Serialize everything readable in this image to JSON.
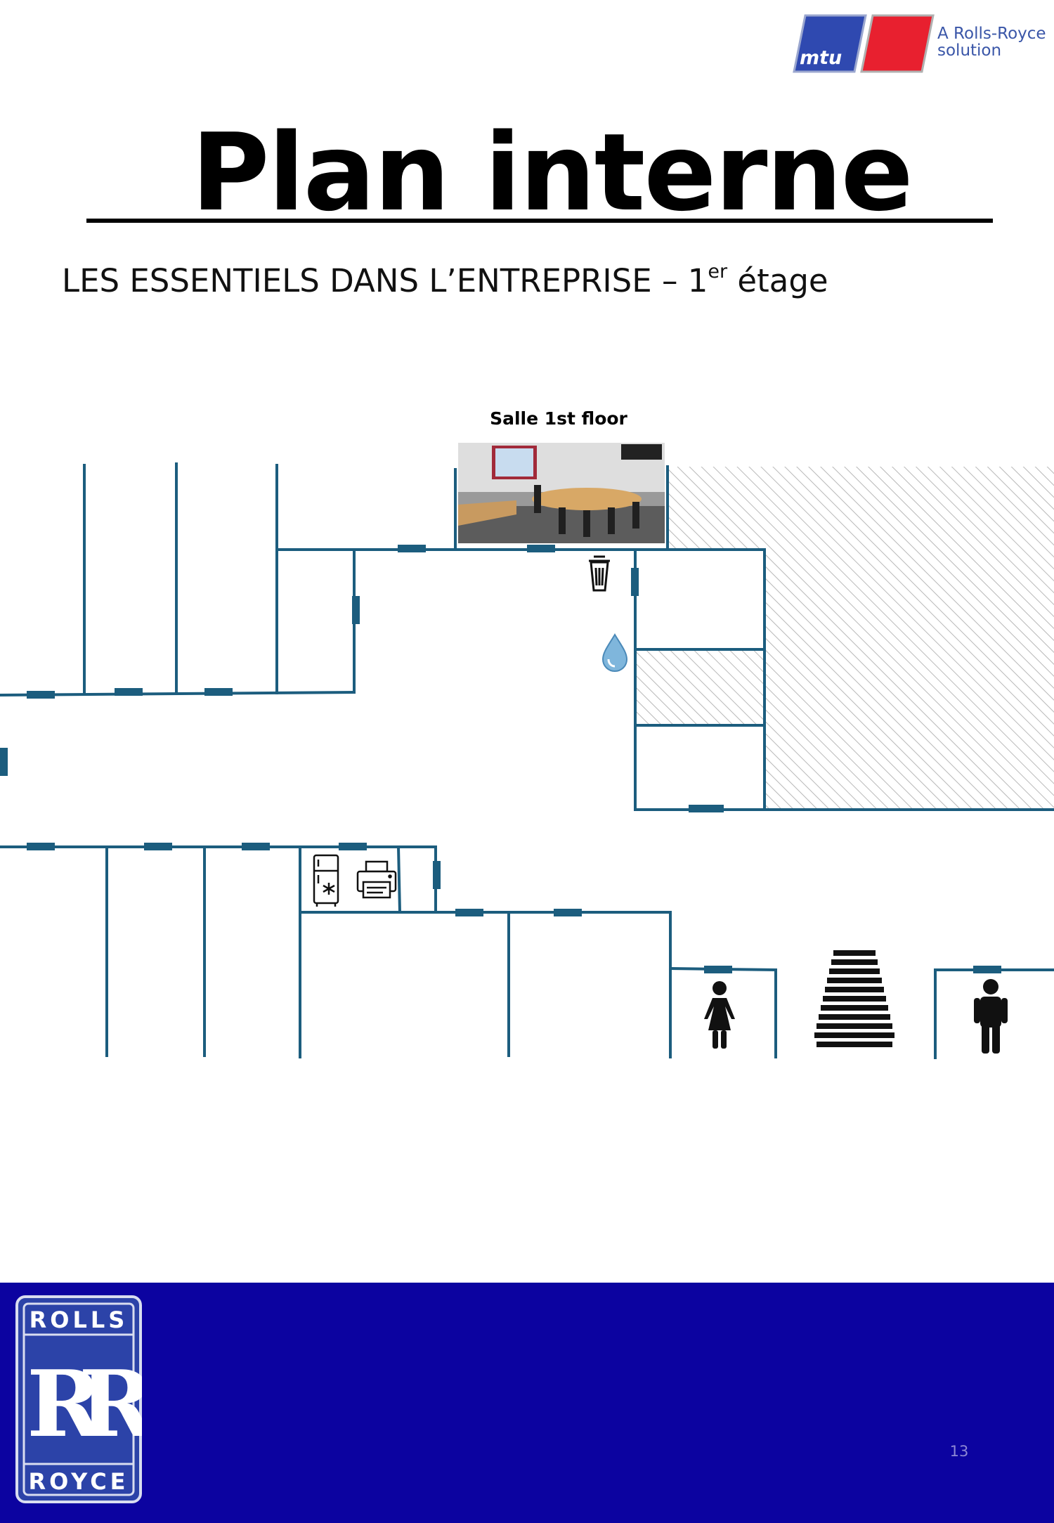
{
  "header": {
    "logo_text": "mtu",
    "brand_line1": "A Rolls-Royce",
    "brand_line2": "solution"
  },
  "title": "Plan interne",
  "subtitle": {
    "text": "LES ESSENTIELS DANS L’ENTREPRISE – 1",
    "superscript": "er",
    "suffix": " étage"
  },
  "meeting_room": {
    "label": "Salle 1st floor"
  },
  "icons": {
    "trash": "trash-icon",
    "water": "water-drop-icon",
    "fridge": "fridge-icon",
    "printer": "printer-icon",
    "women_toilet": "women-toilet-icon",
    "stairs": "stairs-icon",
    "men_toilet": "men-toilet-icon"
  },
  "colors": {
    "wall": "#1c5d7e",
    "footer": "#0c03a0",
    "mtu_blue": "#2f49b0",
    "mtu_red": "#e8202f",
    "brand_text": "#3a56a8",
    "badge": "#2c43a8"
  },
  "footer": {
    "badge_top": "ROLLS",
    "badge_bottom": "ROYCE",
    "badge_monogram": "RR",
    "page_number": "13"
  }
}
